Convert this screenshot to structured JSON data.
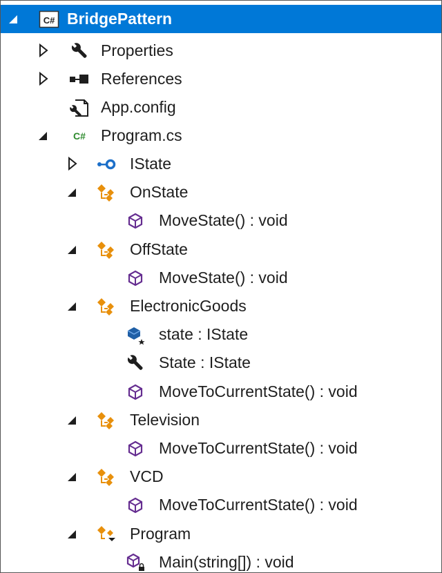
{
  "colors": {
    "selection": "#0078d7",
    "text": "#1e1e1e",
    "class_icon": "#e8900c",
    "method_icon": "#652d90",
    "field_icon": "#1f5fa6",
    "interface_icon": "#1c6fc9",
    "csharp_badge": "#2d8a2d"
  },
  "tree": {
    "project": {
      "label": "BridgePattern",
      "icon": "csharp-project-icon"
    },
    "properties": {
      "label": "Properties",
      "icon": "wrench-icon"
    },
    "references": {
      "label": "References",
      "icon": "references-icon"
    },
    "app_config": {
      "label": "App.config",
      "icon": "config-file-icon"
    },
    "program_cs": {
      "label": "Program.cs",
      "icon": "csharp-file-icon"
    },
    "istate": {
      "label": "IState",
      "icon": "interface-icon"
    },
    "onstate": {
      "label": "OnState",
      "icon": "class-icon"
    },
    "onstate_move": {
      "label": "MoveState() : void",
      "icon": "method-icon"
    },
    "offstate": {
      "label": "OffState",
      "icon": "class-icon"
    },
    "offstate_move": {
      "label": "MoveState() : void",
      "icon": "method-icon"
    },
    "electronic_goods": {
      "label": "ElectronicGoods",
      "icon": "class-icon"
    },
    "eg_state_field": {
      "label": "state : IState",
      "icon": "field-icon"
    },
    "eg_state_prop": {
      "label": "State : IState",
      "icon": "wrench-icon"
    },
    "eg_move": {
      "label": "MoveToCurrentState() : void",
      "icon": "method-icon"
    },
    "television": {
      "label": "Television",
      "icon": "class-icon"
    },
    "tv_move": {
      "label": "MoveToCurrentState() : void",
      "icon": "method-icon"
    },
    "vcd": {
      "label": "VCD",
      "icon": "class-icon"
    },
    "vcd_move": {
      "label": "MoveToCurrentState() : void",
      "icon": "method-icon"
    },
    "program": {
      "label": "Program",
      "icon": "internal-class-icon"
    },
    "program_main": {
      "label": "Main(string[]) : void",
      "icon": "private-method-icon"
    }
  }
}
